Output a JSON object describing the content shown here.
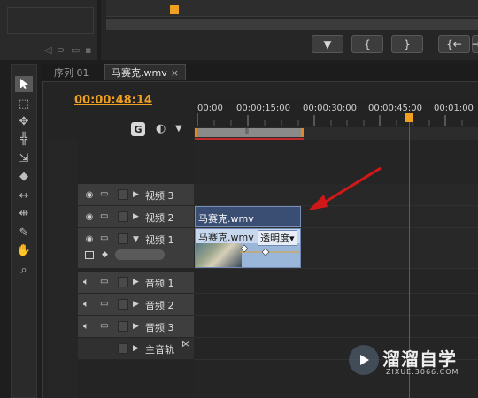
{
  "monitor_controls": {
    "buttons": [
      "▼",
      "{",
      "}",
      "{←",
      "→"
    ]
  },
  "tabs": [
    {
      "label": "序列 01",
      "active": false
    },
    {
      "label": "马赛克.wmv",
      "active": true,
      "close": "×"
    }
  ],
  "timecode": "00:00:48:14",
  "ruler": {
    "ticks": [
      "00:00",
      "00:00:15:00",
      "00:00:30:00",
      "00:00:45:00",
      "00:01:00"
    ]
  },
  "tracks": {
    "video": [
      {
        "name": "视频 3",
        "expanded": false
      },
      {
        "name": "视频 2",
        "expanded": false
      },
      {
        "name": "视频 1",
        "expanded": true
      }
    ],
    "audio": [
      {
        "name": "音频 1"
      },
      {
        "name": "音频 2"
      },
      {
        "name": "音频 3"
      }
    ],
    "master": {
      "name": "主音轨"
    }
  },
  "clips": {
    "v2": {
      "title": "马赛克.wmv"
    },
    "v1": {
      "title": "马赛克.wmv",
      "effect": "透明度",
      "effect_arrow": "▾"
    }
  },
  "watermark": {
    "brand": "溜溜自学",
    "url": "ZIXUE.3066.COM"
  },
  "colors": {
    "timecode": "#f0a020",
    "playhead": "#d02a2a",
    "annotation_arrow": "#d01818",
    "clip_v2": "#3a4d72",
    "clip_v1": "#9ab6d8"
  }
}
